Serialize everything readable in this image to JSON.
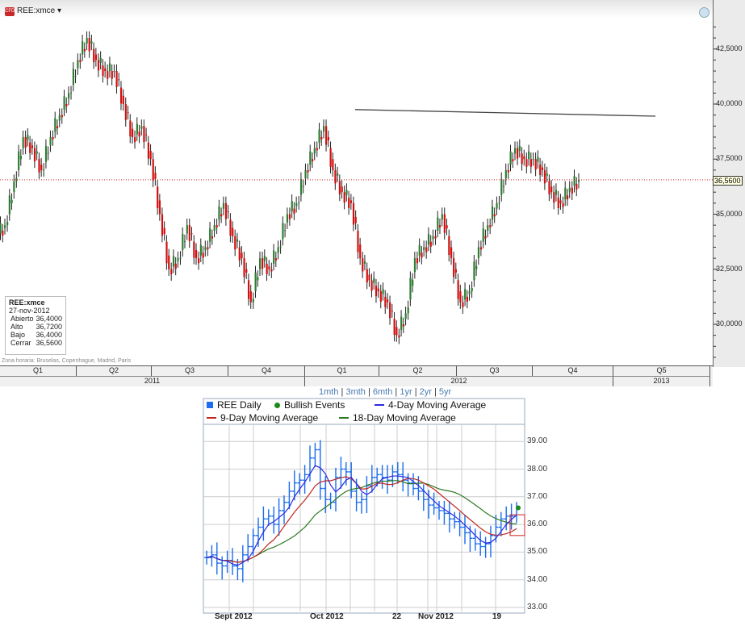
{
  "header": {
    "logo": "CFD",
    "ticker": "REE:xmce"
  },
  "info_box": {
    "symbol": "REE:xmce",
    "date": "27-nov-2012",
    "rows": [
      {
        "label": "Abierto",
        "value": "36,4000"
      },
      {
        "label": "Alto",
        "value": "36,7200"
      },
      {
        "label": "Bajo",
        "value": "36,4000"
      },
      {
        "label": "Cerrar",
        "value": "36,5600"
      }
    ]
  },
  "timezone": "Zona horaria: Bruselas, Copenhague, Madrid, París",
  "last_price_label": "36,5600",
  "periods": [
    "1mth",
    "3mth",
    "6mth",
    "1yr",
    "2yr",
    "5yr"
  ],
  "chart_data": [
    {
      "type": "candlestick",
      "title": "REE:xmce",
      "ylim": [
        28.3,
        44
      ],
      "y_ticks": [
        "42,5000",
        "40,0000",
        "37,5000",
        "35,0000",
        "32,5000",
        "30,0000"
      ],
      "y_tick_values": [
        42.5,
        40,
        37.5,
        35,
        32.5,
        30
      ],
      "quarters": [
        "Q1",
        "Q2",
        "Q3",
        "Q4",
        "Q1",
        "Q2",
        "Q3",
        "Q4",
        "Q5"
      ],
      "years": [
        "2011",
        "2012",
        "2013"
      ],
      "weekly_close": [
        34.5,
        36.5,
        38.5,
        38,
        37,
        38.5,
        39.5,
        40.5,
        42,
        43,
        42,
        41.5,
        41.5,
        40,
        38.5,
        39,
        37.5,
        35,
        32.5,
        33,
        34.5,
        33,
        33.5,
        34.5,
        35.5,
        34,
        33,
        31,
        33,
        32.5,
        33.5,
        35,
        35.5,
        37,
        38,
        39,
        37,
        36,
        35.5,
        33,
        32,
        31.5,
        31,
        29.5,
        30.5,
        33,
        33.5,
        34,
        35,
        33,
        31,
        31.5,
        33.5,
        34.5,
        35.5,
        37,
        38,
        37.5,
        37.5,
        37,
        36,
        35.5,
        36.2,
        36.56
      ],
      "last_price": 36.56,
      "trendline": [
        39.75,
        39.45
      ]
    },
    {
      "type": "line",
      "ylim": [
        32.9,
        39.6
      ],
      "y_ticks": [
        "39.00",
        "38.00",
        "37.00",
        "36.00",
        "35.00",
        "34.00",
        "33.00"
      ],
      "y_tick_values": [
        39,
        38,
        37,
        36,
        35,
        34,
        33
      ],
      "x_labels": [
        "Sept 2012",
        "Oct 2012",
        "22",
        "Nov 2012",
        "19"
      ],
      "legend": [
        "REE Daily",
        "Bullish Events",
        "4-Day Moving Average",
        "9-Day Moving Average",
        "18-Day Moving Average"
      ],
      "colors": {
        "daily": "#1a6cf0",
        "bullish": "#1d8a1d",
        "ma4": "#2a2ae0",
        "ma9": "#c0281e",
        "ma18": "#2a7a1e"
      },
      "daily_close": [
        34.8,
        34.9,
        34.6,
        34.5,
        34.7,
        34.5,
        34.4,
        34.9,
        35.2,
        35.6,
        35.9,
        36.2,
        36.3,
        36.0,
        36.5,
        36.8,
        37.2,
        37.5,
        37.6,
        37.8,
        38.4,
        38.7,
        37.3,
        36.9,
        36.8,
        37.7,
        38.0,
        37.9,
        37.2,
        36.8,
        36.9,
        37.4,
        37.7,
        37.8,
        37.7,
        37.6,
        37.9,
        37.8,
        37.6,
        37.5,
        37.3,
        37.2,
        36.9,
        36.7,
        36.6,
        36.5,
        36.4,
        36.2,
        36.1,
        35.9,
        35.7,
        35.5,
        35.3,
        35.2,
        35.3,
        35.6,
        35.9,
        36.2,
        36.3,
        36.3,
        36.56
      ],
      "bullish_event_value": 36.6
    }
  ]
}
